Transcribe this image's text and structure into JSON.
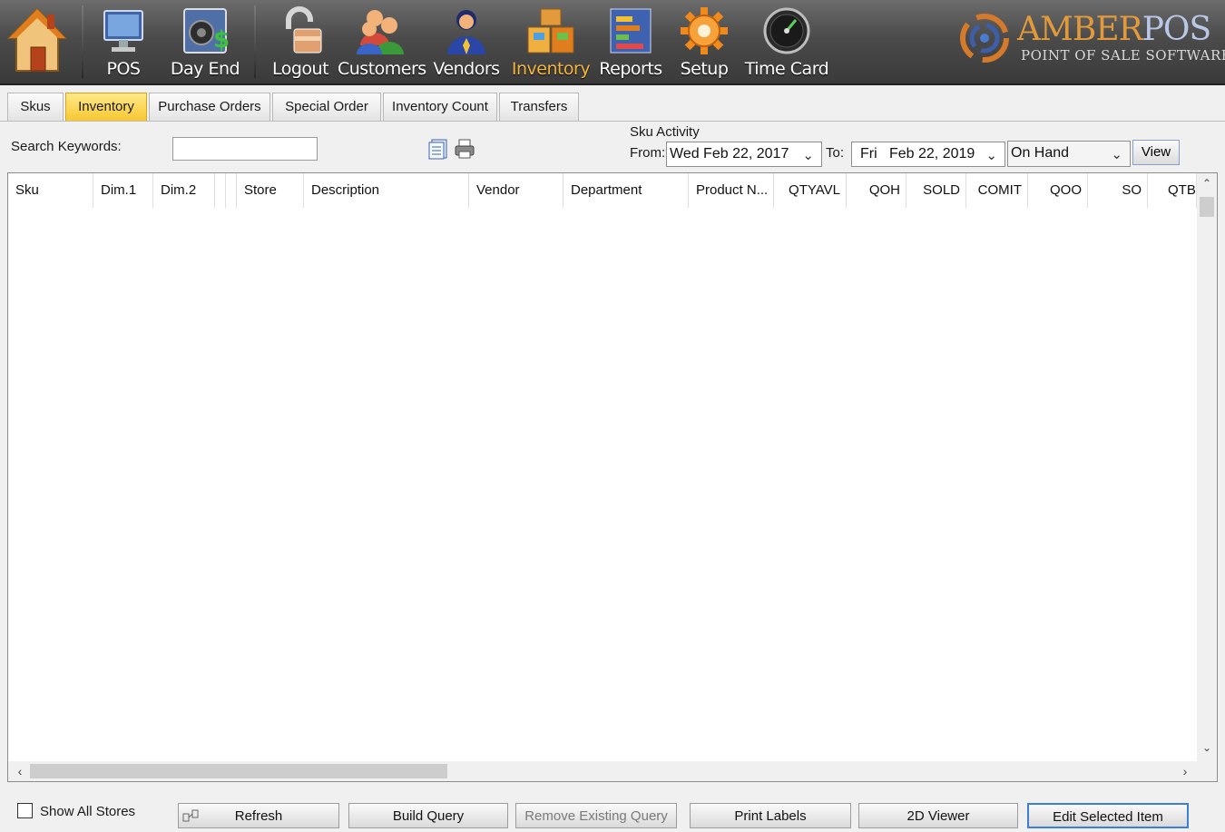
{
  "toolbar": {
    "items": [
      {
        "label": "",
        "icon": "home-icon"
      },
      {
        "label": "POS",
        "icon": "pos-monitor-icon"
      },
      {
        "label": "Day End",
        "icon": "safe-dollar-icon"
      },
      {
        "label": "Logout",
        "icon": "padlock-icon"
      },
      {
        "label": "Customers",
        "icon": "customers-icon"
      },
      {
        "label": "Vendors",
        "icon": "vendor-person-icon"
      },
      {
        "label": "Inventory",
        "icon": "inventory-boxes-icon"
      },
      {
        "label": "Reports",
        "icon": "reports-chart-icon"
      },
      {
        "label": "Setup",
        "icon": "gear-icon"
      },
      {
        "label": "Time Card",
        "icon": "clock-icon"
      }
    ],
    "active": "Inventory",
    "active_color": "#f6b53c"
  },
  "logo": {
    "brand_a": "AMBER",
    "brand_b": "POS",
    "tagline": "POINT OF SALE SOFTWARE"
  },
  "tabs": [
    "Skus",
    "Inventory",
    "Purchase Orders",
    "Special Order",
    "Inventory Count",
    "Transfers"
  ],
  "active_tab": "Inventory",
  "search": {
    "label": "Search Keywords:",
    "value": ""
  },
  "activity": {
    "title": "Sku Activity",
    "from_label": "From:",
    "from_value": "Wed Feb 22, 2017",
    "to_label": "To:",
    "to_value": "Fri   Feb 22, 2019",
    "mode": "On Hand",
    "view_label": "View"
  },
  "grid": {
    "columns": [
      "Sku",
      "Dim.1",
      "Dim.2",
      "",
      "Store",
      "Description",
      "Vendor",
      "Department",
      "Product N...",
      "QTYAVL",
      "QOH",
      "SOLD",
      "COMIT",
      "QOO",
      "SO",
      "QTBI"
    ],
    "rows": []
  },
  "footer": {
    "show_all_stores": "Show All Stores",
    "show_all_checked": false,
    "buttons": [
      "Refresh",
      "Build Query",
      "Remove Existing Query",
      "Print Labels",
      "2D Viewer",
      "Edit Selected Item"
    ]
  }
}
